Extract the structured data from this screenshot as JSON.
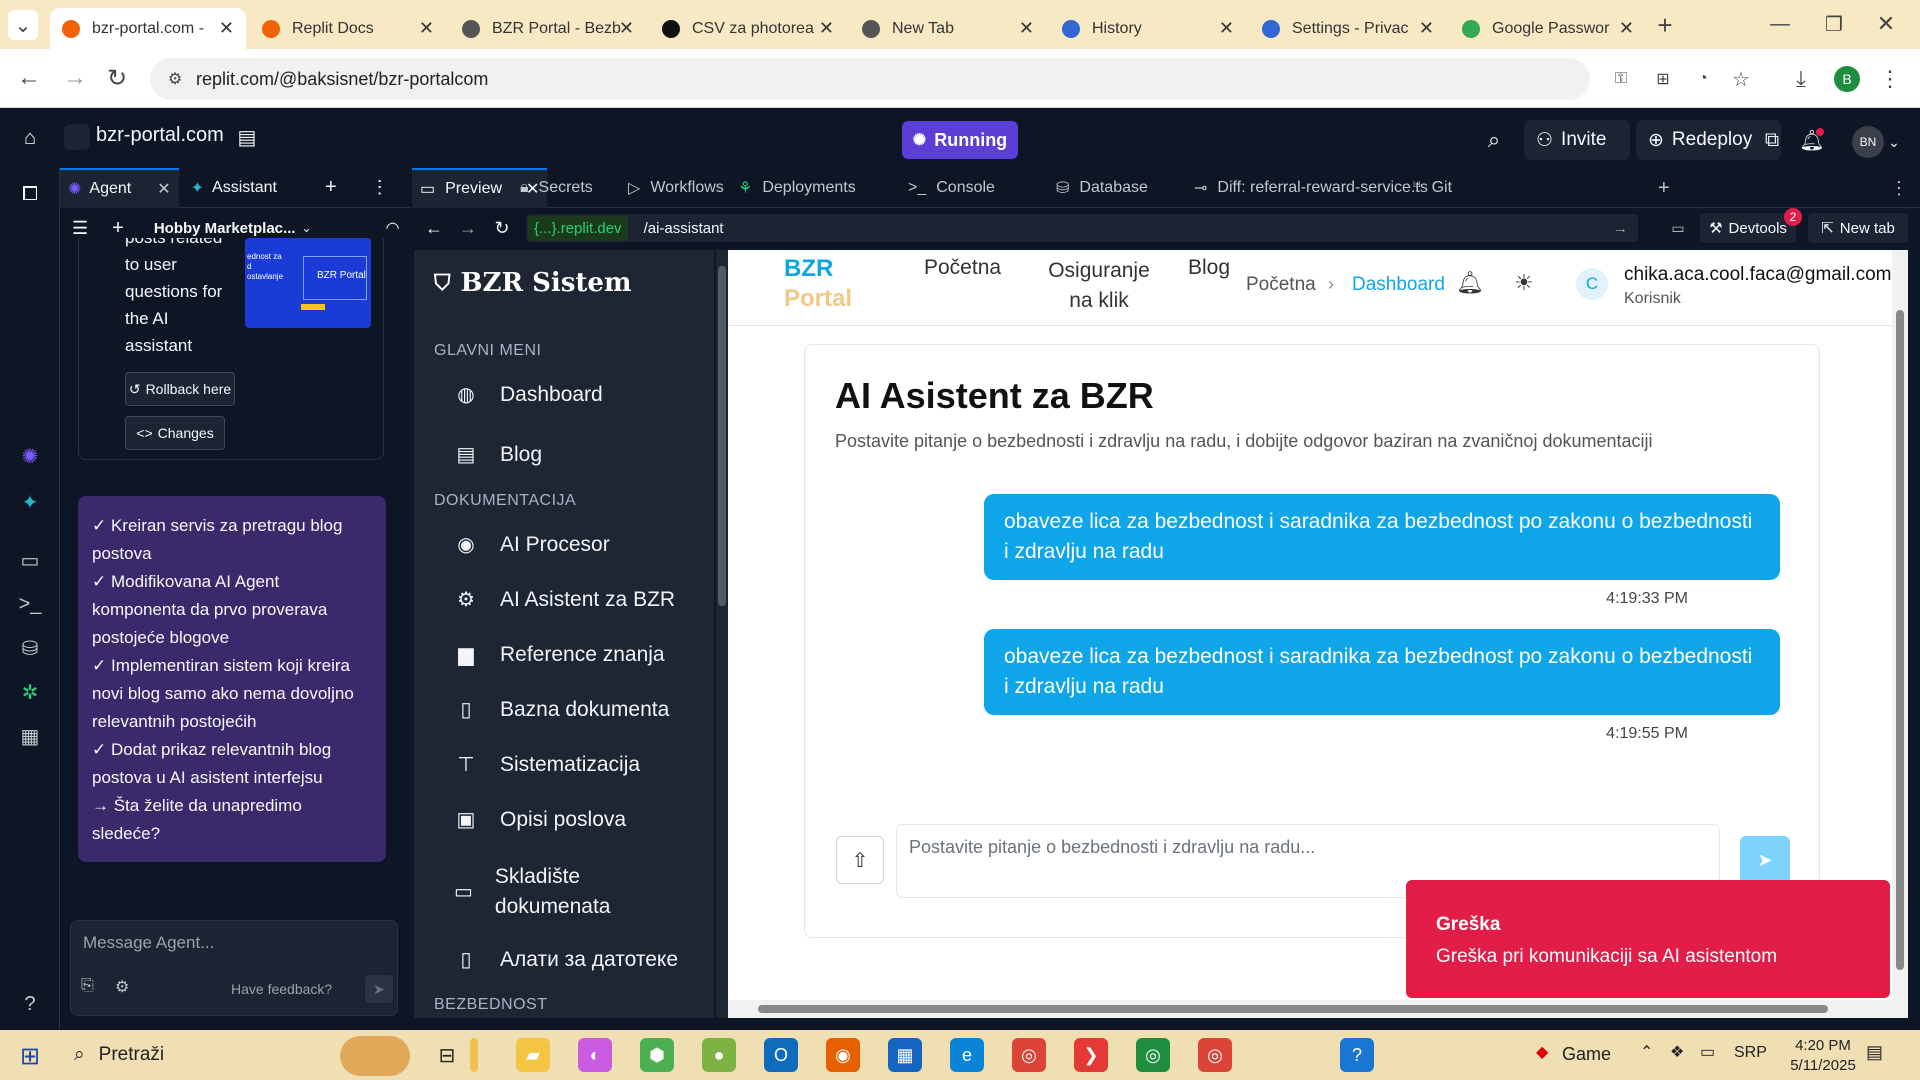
{
  "browser": {
    "tabs": [
      {
        "title": "bzr-portal.com -",
        "active": true,
        "fav_color": "#f26207"
      },
      {
        "title": "Replit Docs",
        "fav_color": "#f26207"
      },
      {
        "title": "BZR Portal - Bezb",
        "fav_color": "#555555"
      },
      {
        "title": "CSV za photorea",
        "fav_color": "#111111"
      },
      {
        "title": "New Tab",
        "fav_color": "#555555"
      },
      {
        "title": "History",
        "fav_color": "#3367d6"
      },
      {
        "title": "Settings - Privac",
        "fav_color": "#3367d6"
      },
      {
        "title": "Google Passwor",
        "fav_color": "#34a853"
      }
    ],
    "url": "replit.com/@baksisnet/bzr-portalcom",
    "profile_initial": "B"
  },
  "replit": {
    "project_name": "bzr-portal.com",
    "run_status": "Running",
    "invite_label": "Invite",
    "redeploy_label": "Redeploy",
    "user_initials": "BN",
    "left_tabs": {
      "agent": "Agent",
      "assistant": "Assistant"
    },
    "project_selector": "Hobby Marketplac...",
    "work_tabs": [
      "Preview",
      "Secrets",
      "Workflows",
      "Deployments",
      "Console",
      "Database",
      "Diff: referral-reward-service.ts",
      "Git"
    ],
    "preview": {
      "domain": "{...}.replit.dev",
      "path": "/ai-assistant",
      "devtools_label": "Devtools",
      "devtools_badge": "2",
      "new_tab_label": "New tab"
    }
  },
  "agent": {
    "checkpoint_text": [
      "posts related",
      "to user",
      "questions for",
      "the AI",
      "assistant"
    ],
    "thumb_title": "BZR Portal",
    "thumb_lines": [
      "ednost za",
      "d",
      "ostavlanje"
    ],
    "rollback_label": "Rollback here",
    "changes_label": "Changes",
    "summary": [
      "✓ Kreiran servis za pretragu blog postova",
      "✓ Modifikovana AI Agent komponenta da prvo proverava postojeće blogove",
      "✓ Implementiran sistem koji kreira novi blog samo ako nema dovoljno relevantnih postojećih",
      "✓ Dodat prikaz relevantnih blog postova u AI asistent interfejsu",
      "→ Šta želite da unapredimo sledeće?"
    ],
    "input_placeholder": "Message Agent...",
    "feedback_label": "Have feedback?"
  },
  "site": {
    "brand": "BZR Sistem",
    "logo_line1": "BZR",
    "logo_line2": "Portal",
    "top_nav": [
      "Početna",
      "Osiguranje na klik",
      "Blog"
    ],
    "breadcrumb": [
      "Početna",
      "Dashboard"
    ],
    "user_email": "chika.aca.cool.faca@gmail.com",
    "user_role": "Korisnik",
    "user_initial": "C",
    "sidebar": {
      "section_main": "GLAVNI MENI",
      "section_docs": "DOKUMENTACIJA",
      "section_safety": "BEZBEDNOST",
      "main_items": [
        "Dashboard",
        "Blog"
      ],
      "doc_items": [
        "AI Procesor",
        "AI Asistent za BZR",
        "Reference znanja",
        "Bazna dokumenta",
        "Sistematizacija",
        "Opisi poslova",
        "Skladište dokumenata",
        "Алати за датотеке"
      ]
    },
    "page_title": "AI Asistent za BZR",
    "page_subtitle": "Postavite pitanje o bezbednosti i zdravlju na radu, i dobijte odgovor baziran na zvaničnoj dokumentaciji",
    "messages": [
      {
        "text": "obaveze lica za bezbednost i saradnika za bezbednost po zakonu o bezbednosti i zdravlju na radu",
        "time": "4:19:33 PM"
      },
      {
        "text": "obaveze lica za bezbednost i saradnika za bezbednost po zakonu o bezbednosti i zdravlju na radu",
        "time": "4:19:55 PM"
      }
    ],
    "input_placeholder": "Postavite pitanje o bezbednosti i zdravlju na radu...",
    "toast_title": "Greška",
    "toast_text": "Greška pri komunikaciji sa AI asistentom"
  },
  "taskbar": {
    "search_placeholder": "Pretraži",
    "game_label": "Game",
    "lang": "SRP",
    "time": "4:20 PM",
    "date": "5/11/2025"
  }
}
